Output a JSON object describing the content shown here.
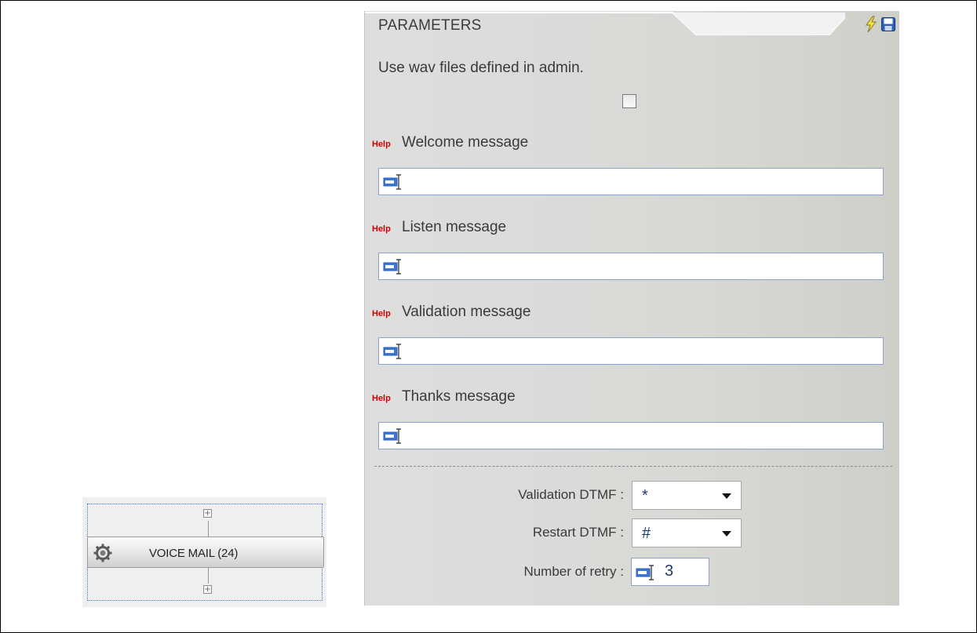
{
  "node": {
    "label": "VOICE MAIL (24)",
    "icon": "gear-icon",
    "expand_top": "+",
    "expand_bottom": "+"
  },
  "panel": {
    "title": "PARAMETERS",
    "icons": [
      "lightning-icon",
      "save-icon"
    ],
    "use_wav_text": "Use wav files defined in admin.",
    "use_wav_checked": false,
    "help_label": "Help",
    "fields": [
      {
        "label": "Welcome message",
        "value": ""
      },
      {
        "label": "Listen message",
        "value": ""
      },
      {
        "label": "Validation message",
        "value": ""
      },
      {
        "label": "Thanks message",
        "value": ""
      }
    ],
    "validation_dtmf": {
      "label": "Validation DTMF :",
      "value": "*"
    },
    "restart_dtmf": {
      "label": "Restart DTMF :",
      "value": "#"
    },
    "number_of_retry": {
      "label": "Number of retry :",
      "value": "3"
    }
  },
  "colors": {
    "help_red": "#d10000",
    "input_border": "#8aa3c3",
    "node_selection": "#3b78d8",
    "value_text": "#1e3a6b"
  }
}
